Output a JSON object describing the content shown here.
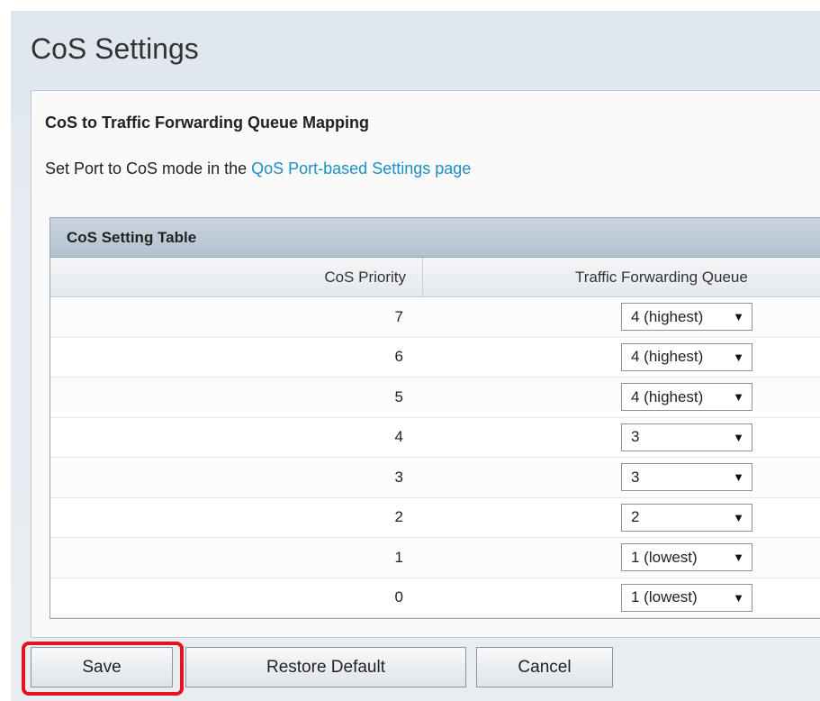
{
  "page": {
    "title": "CoS Settings"
  },
  "section": {
    "heading": "CoS to Traffic Forwarding Queue Mapping",
    "note_prefix": "Set Port to CoS mode in the ",
    "note_link": "QoS Port-based Settings page"
  },
  "table": {
    "caption": "CoS Setting Table",
    "columns": [
      "CoS Priority",
      "Traffic Forwarding Queue"
    ],
    "rows": [
      {
        "priority": "7",
        "queue": "4 (highest)"
      },
      {
        "priority": "6",
        "queue": "4 (highest)"
      },
      {
        "priority": "5",
        "queue": "4 (highest)"
      },
      {
        "priority": "4",
        "queue": "3"
      },
      {
        "priority": "3",
        "queue": "3"
      },
      {
        "priority": "2",
        "queue": "2"
      },
      {
        "priority": "1",
        "queue": "1 (lowest)"
      },
      {
        "priority": "0",
        "queue": "1 (lowest)"
      }
    ],
    "dropdown_icon": "triangle-down-icon"
  },
  "buttons": {
    "save": "Save",
    "restore": "Restore Default",
    "cancel": "Cancel"
  },
  "colors": {
    "link": "#1d8fc4",
    "highlight": "#e3141f"
  }
}
